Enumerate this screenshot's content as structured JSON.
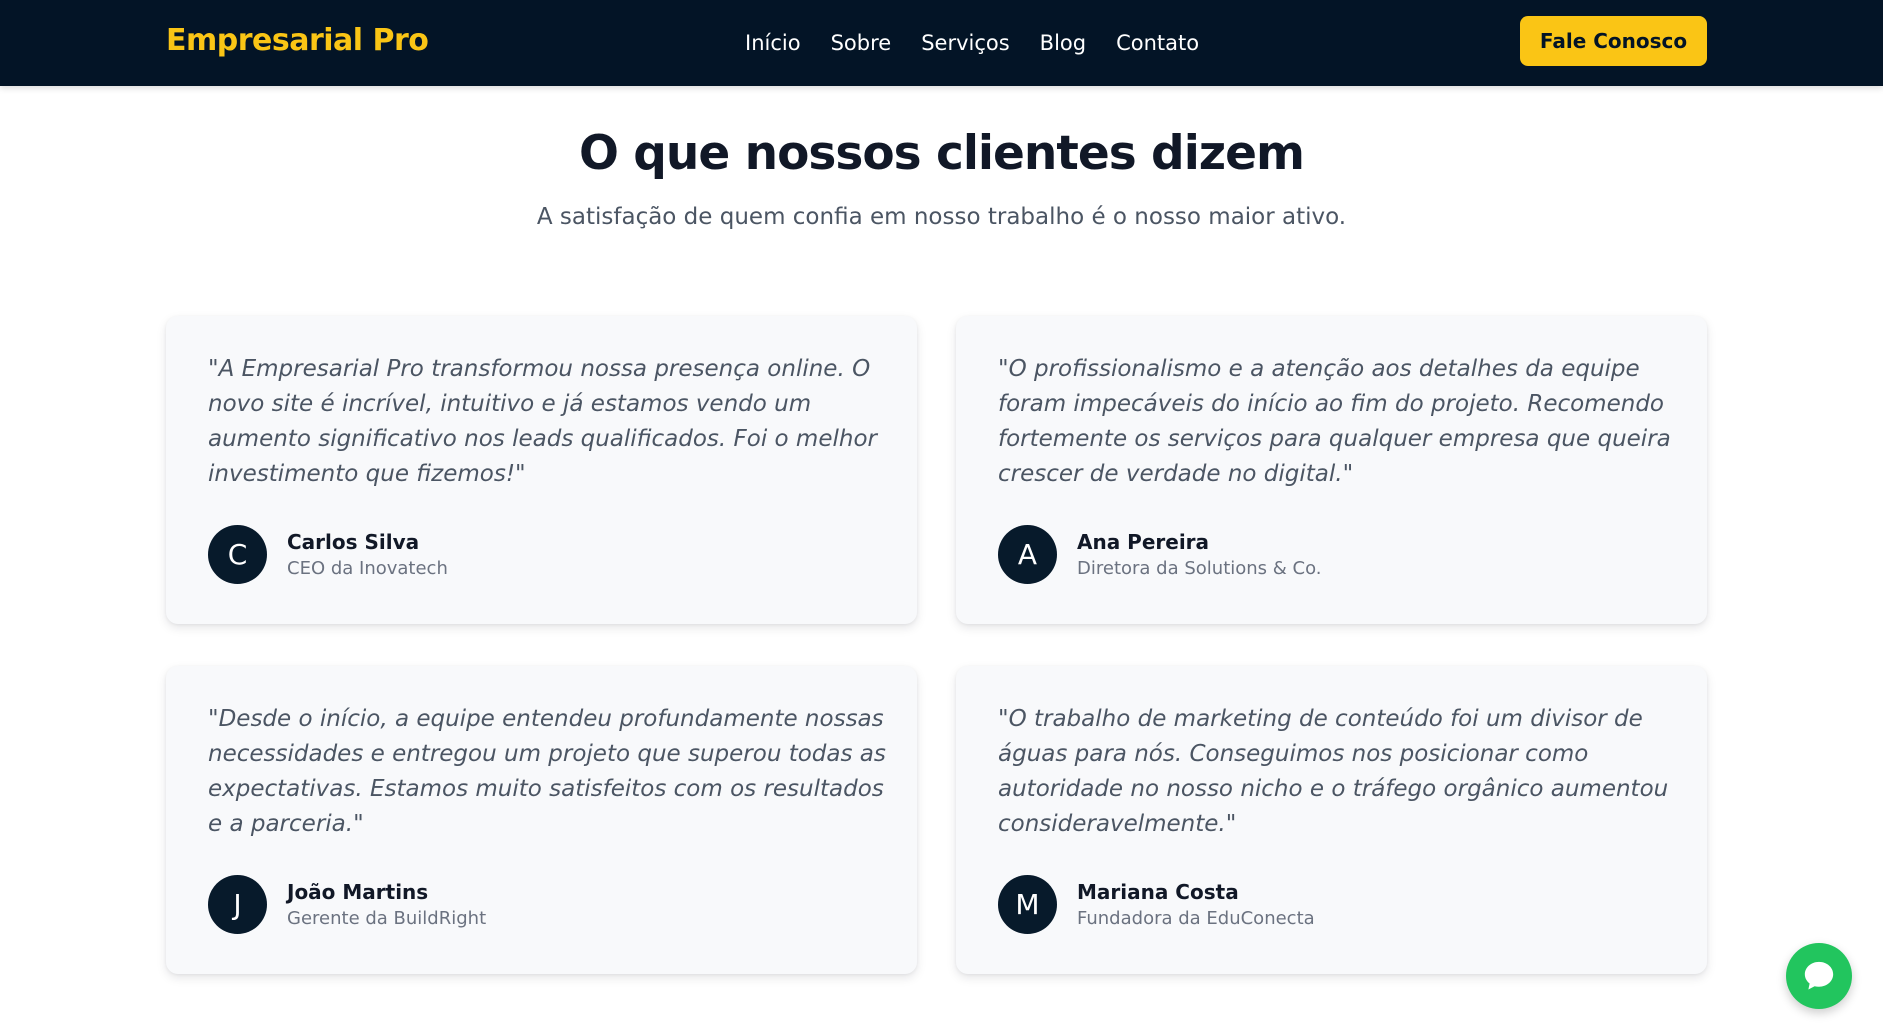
{
  "colors": {
    "navbar_bg": "#031426",
    "accent": "#fac515",
    "chat_button": "#22c55e",
    "avatar_bg": "#071a2b"
  },
  "header": {
    "logo": "Empresarial Pro",
    "nav": [
      "Início",
      "Sobre",
      "Serviços",
      "Blog",
      "Contato"
    ],
    "cta_label": "Fale Conosco"
  },
  "section": {
    "title": "O que nossos clientes dizem",
    "subtitle": "A satisfação de quem confia em nosso trabalho é o nosso maior ativo."
  },
  "testimonials": [
    {
      "quote": "\"A Empresarial Pro transformou nossa presença online. O novo site é incrível, intuitivo e já estamos vendo um aumento significativo nos leads qualificados. Foi o melhor investimento que fizemos!\"",
      "initial": "C",
      "name": "Carlos Silva",
      "role": "CEO da Inovatech"
    },
    {
      "quote": "\"O profissionalismo e a atenção aos detalhes da equipe foram impecáveis do início ao fim do projeto. Recomendo fortemente os serviços para qualquer empresa que queira crescer de verdade no digital.\"",
      "initial": "A",
      "name": "Ana Pereira",
      "role": "Diretora da Solutions & Co."
    },
    {
      "quote": "\"Desde o início, a equipe entendeu profundamente nossas necessidades e entregou um projeto que superou todas as expectativas. Estamos muito satisfeitos com os resultados e a parceria.\"",
      "initial": "J",
      "name": "João Martins",
      "role": "Gerente da BuildRight"
    },
    {
      "quote": "\"O trabalho de marketing de conteúdo foi um divisor de águas para nós. Conseguimos nos posicionar como autoridade no nosso nicho e o tráfego orgânico aumentou consideravelmente.\"",
      "initial": "M",
      "name": "Mariana Costa",
      "role": "Fundadora da EduConecta"
    }
  ],
  "chat": {
    "icon": "chat-bubble-icon"
  }
}
